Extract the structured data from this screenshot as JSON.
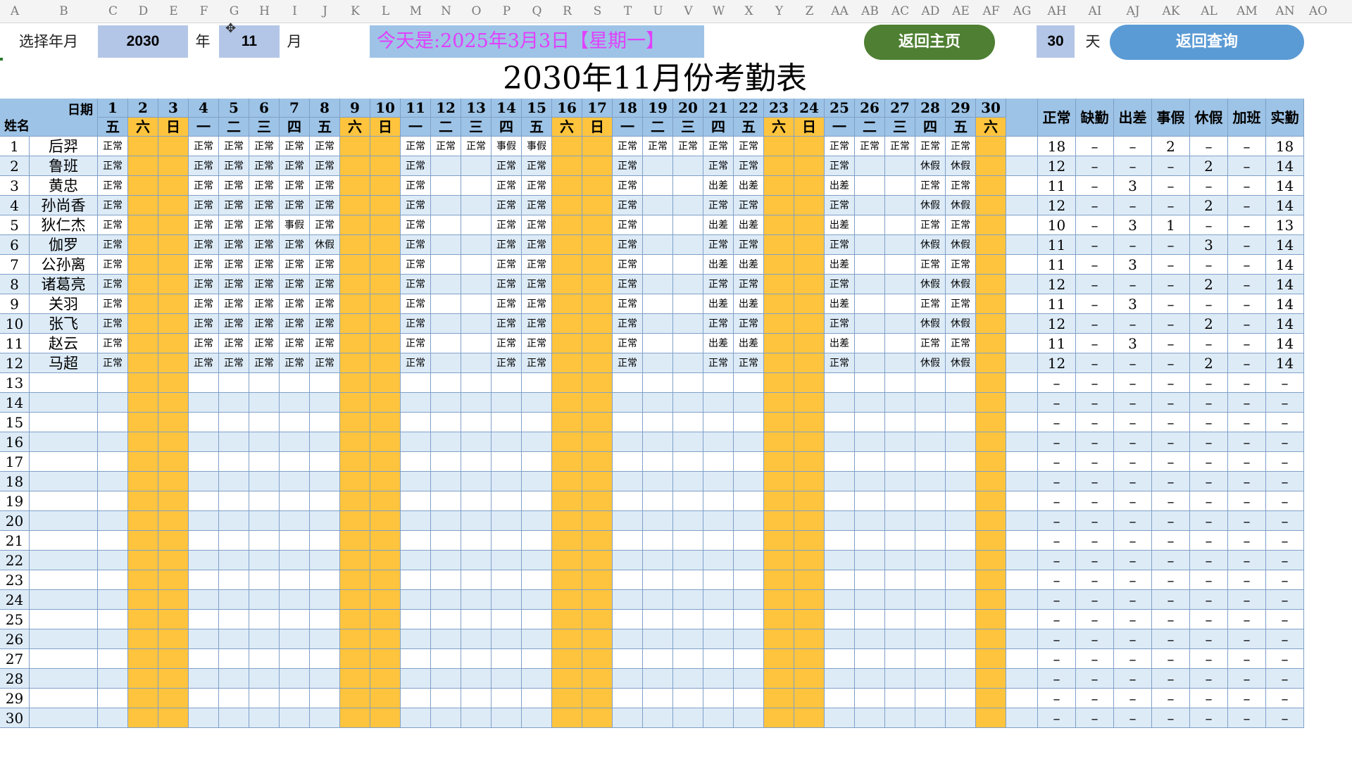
{
  "column_letters": [
    "A",
    "B",
    "C",
    "D",
    "E",
    "F",
    "G",
    "H",
    "I",
    "J",
    "K",
    "L",
    "M",
    "N",
    "O",
    "P",
    "Q",
    "R",
    "S",
    "T",
    "U",
    "V",
    "W",
    "X",
    "Y",
    "Z",
    "AA",
    "AB",
    "AC",
    "AD",
    "AE",
    "AF",
    "AG",
    "AH",
    "AI",
    "AJ",
    "AK",
    "AL",
    "AM",
    "AN",
    "AO"
  ],
  "controls": {
    "select_label": "选择年月",
    "year_value": "2030",
    "year_unit": "年",
    "month_value": "11",
    "month_unit": "月",
    "today_text": "今天是:2025年3月3日【星期一】",
    "home_button": "返回主页",
    "days_value": "30",
    "days_unit": "天",
    "query_button": "返回查询"
  },
  "title": "2030年11月份考勤表",
  "header": {
    "date_label": "日期",
    "name_label": "姓名",
    "days": [
      "1",
      "2",
      "3",
      "4",
      "5",
      "6",
      "7",
      "8",
      "9",
      "10",
      "11",
      "12",
      "13",
      "14",
      "15",
      "16",
      "17",
      "18",
      "19",
      "20",
      "21",
      "22",
      "23",
      "24",
      "25",
      "26",
      "27",
      "28",
      "29",
      "30"
    ],
    "weekdays": [
      "五",
      "六",
      "日",
      "一",
      "二",
      "三",
      "四",
      "五",
      "六",
      "日",
      "一",
      "二",
      "三",
      "四",
      "五",
      "六",
      "日",
      "一",
      "二",
      "三",
      "四",
      "五",
      "六",
      "日",
      "一",
      "二",
      "三",
      "四",
      "五",
      "六"
    ],
    "summary": [
      "正常",
      "缺勤",
      "出差",
      "事假",
      "休假",
      "加班",
      "实勤"
    ]
  },
  "weekend_days": [
    2,
    3,
    9,
    10,
    16,
    17,
    23,
    24,
    30
  ],
  "rows": [
    {
      "no": "1",
      "name": "后羿",
      "marks": {
        "1": "正常",
        "4": "正常",
        "5": "正常",
        "6": "正常",
        "7": "正常",
        "8": "正常",
        "11": "正常",
        "12": "正常",
        "13": "正常",
        "14": "事假",
        "15": "事假",
        "18": "正常",
        "19": "正常",
        "20": "正常",
        "21": "正常",
        "22": "正常",
        "25": "正常",
        "26": "正常",
        "27": "正常",
        "28": "正常",
        "29": "正常"
      },
      "summary": [
        "18",
        "–",
        "–",
        "2",
        "–",
        "–",
        "18"
      ]
    },
    {
      "no": "2",
      "name": "鲁班",
      "marks": {
        "1": "正常",
        "4": "正常",
        "5": "正常",
        "6": "正常",
        "7": "正常",
        "8": "正常",
        "11": "正常",
        "14": "正常",
        "15": "正常",
        "18": "正常",
        "21": "正常",
        "22": "正常",
        "25": "正常",
        "28": "休假",
        "29": "休假"
      },
      "summary": [
        "12",
        "–",
        "–",
        "–",
        "2",
        "–",
        "14"
      ]
    },
    {
      "no": "3",
      "name": "黄忠",
      "marks": {
        "1": "正常",
        "4": "正常",
        "5": "正常",
        "6": "正常",
        "7": "正常",
        "8": "正常",
        "11": "正常",
        "14": "正常",
        "15": "正常",
        "18": "正常",
        "21": "出差",
        "22": "出差",
        "25": "出差",
        "28": "正常",
        "29": "正常"
      },
      "summary": [
        "11",
        "–",
        "3",
        "–",
        "–",
        "–",
        "14"
      ]
    },
    {
      "no": "4",
      "name": "孙尚香",
      "marks": {
        "1": "正常",
        "4": "正常",
        "5": "正常",
        "6": "正常",
        "7": "正常",
        "8": "正常",
        "11": "正常",
        "14": "正常",
        "15": "正常",
        "18": "正常",
        "21": "正常",
        "22": "正常",
        "25": "正常",
        "28": "休假",
        "29": "休假"
      },
      "summary": [
        "12",
        "–",
        "–",
        "–",
        "2",
        "–",
        "14"
      ]
    },
    {
      "no": "5",
      "name": "狄仁杰",
      "marks": {
        "1": "正常",
        "4": "正常",
        "5": "正常",
        "6": "正常",
        "7": "事假",
        "8": "正常",
        "11": "正常",
        "14": "正常",
        "15": "正常",
        "18": "正常",
        "21": "出差",
        "22": "出差",
        "25": "出差",
        "28": "正常",
        "29": "正常"
      },
      "summary": [
        "10",
        "–",
        "3",
        "1",
        "–",
        "–",
        "13"
      ]
    },
    {
      "no": "6",
      "name": "伽罗",
      "marks": {
        "1": "正常",
        "4": "正常",
        "5": "正常",
        "6": "正常",
        "7": "正常",
        "8": "休假",
        "11": "正常",
        "14": "正常",
        "15": "正常",
        "18": "正常",
        "21": "正常",
        "22": "正常",
        "25": "正常",
        "28": "休假",
        "29": "休假"
      },
      "summary": [
        "11",
        "–",
        "–",
        "–",
        "3",
        "–",
        "14"
      ]
    },
    {
      "no": "7",
      "name": "公孙离",
      "marks": {
        "1": "正常",
        "4": "正常",
        "5": "正常",
        "6": "正常",
        "7": "正常",
        "8": "正常",
        "11": "正常",
        "14": "正常",
        "15": "正常",
        "18": "正常",
        "21": "出差",
        "22": "出差",
        "25": "出差",
        "28": "正常",
        "29": "正常"
      },
      "summary": [
        "11",
        "–",
        "3",
        "–",
        "–",
        "–",
        "14"
      ]
    },
    {
      "no": "8",
      "name": "诸葛亮",
      "marks": {
        "1": "正常",
        "4": "正常",
        "5": "正常",
        "6": "正常",
        "7": "正常",
        "8": "正常",
        "11": "正常",
        "14": "正常",
        "15": "正常",
        "18": "正常",
        "21": "正常",
        "22": "正常",
        "25": "正常",
        "28": "休假",
        "29": "休假"
      },
      "summary": [
        "12",
        "–",
        "–",
        "–",
        "2",
        "–",
        "14"
      ]
    },
    {
      "no": "9",
      "name": "关羽",
      "marks": {
        "1": "正常",
        "4": "正常",
        "5": "正常",
        "6": "正常",
        "7": "正常",
        "8": "正常",
        "11": "正常",
        "14": "正常",
        "15": "正常",
        "18": "正常",
        "21": "出差",
        "22": "出差",
        "25": "出差",
        "28": "正常",
        "29": "正常"
      },
      "summary": [
        "11",
        "–",
        "3",
        "–",
        "–",
        "–",
        "14"
      ]
    },
    {
      "no": "10",
      "name": "张飞",
      "marks": {
        "1": "正常",
        "4": "正常",
        "5": "正常",
        "6": "正常",
        "7": "正常",
        "8": "正常",
        "11": "正常",
        "14": "正常",
        "15": "正常",
        "18": "正常",
        "21": "正常",
        "22": "正常",
        "25": "正常",
        "28": "休假",
        "29": "休假"
      },
      "summary": [
        "12",
        "–",
        "–",
        "–",
        "2",
        "–",
        "14"
      ]
    },
    {
      "no": "11",
      "name": "赵云",
      "marks": {
        "1": "正常",
        "4": "正常",
        "5": "正常",
        "6": "正常",
        "7": "正常",
        "8": "正常",
        "11": "正常",
        "14": "正常",
        "15": "正常",
        "18": "正常",
        "21": "出差",
        "22": "出差",
        "25": "出差",
        "28": "正常",
        "29": "正常"
      },
      "summary": [
        "11",
        "–",
        "3",
        "–",
        "–",
        "–",
        "14"
      ]
    },
    {
      "no": "12",
      "name": "马超",
      "marks": {
        "1": "正常",
        "4": "正常",
        "5": "正常",
        "6": "正常",
        "7": "正常",
        "8": "正常",
        "11": "正常",
        "14": "正常",
        "15": "正常",
        "18": "正常",
        "21": "正常",
        "22": "正常",
        "25": "正常",
        "28": "休假",
        "29": "休假"
      },
      "summary": [
        "12",
        "–",
        "–",
        "–",
        "2",
        "–",
        "14"
      ]
    },
    {
      "no": "13",
      "name": "",
      "marks": {},
      "summary": [
        "–",
        "–",
        "–",
        "–",
        "–",
        "–",
        "–"
      ]
    },
    {
      "no": "14",
      "name": "",
      "marks": {},
      "summary": [
        "–",
        "–",
        "–",
        "–",
        "–",
        "–",
        "–"
      ]
    },
    {
      "no": "15",
      "name": "",
      "marks": {},
      "summary": [
        "–",
        "–",
        "–",
        "–",
        "–",
        "–",
        "–"
      ]
    },
    {
      "no": "16",
      "name": "",
      "marks": {},
      "summary": [
        "–",
        "–",
        "–",
        "–",
        "–",
        "–",
        "–"
      ]
    },
    {
      "no": "17",
      "name": "",
      "marks": {},
      "summary": [
        "–",
        "–",
        "–",
        "–",
        "–",
        "–",
        "–"
      ]
    },
    {
      "no": "18",
      "name": "",
      "marks": {},
      "summary": [
        "–",
        "–",
        "–",
        "–",
        "–",
        "–",
        "–"
      ]
    },
    {
      "no": "19",
      "name": "",
      "marks": {},
      "summary": [
        "–",
        "–",
        "–",
        "–",
        "–",
        "–",
        "–"
      ]
    },
    {
      "no": "20",
      "name": "",
      "marks": {},
      "summary": [
        "–",
        "–",
        "–",
        "–",
        "–",
        "–",
        "–"
      ]
    },
    {
      "no": "21",
      "name": "",
      "marks": {},
      "summary": [
        "–",
        "–",
        "–",
        "–",
        "–",
        "–",
        "–"
      ]
    },
    {
      "no": "22",
      "name": "",
      "marks": {},
      "summary": [
        "–",
        "–",
        "–",
        "–",
        "–",
        "–",
        "–"
      ]
    },
    {
      "no": "23",
      "name": "",
      "marks": {},
      "summary": [
        "–",
        "–",
        "–",
        "–",
        "–",
        "–",
        "–"
      ]
    },
    {
      "no": "24",
      "name": "",
      "marks": {},
      "summary": [
        "–",
        "–",
        "–",
        "–",
        "–",
        "–",
        "–"
      ]
    },
    {
      "no": "25",
      "name": "",
      "marks": {},
      "summary": [
        "–",
        "–",
        "–",
        "–",
        "–",
        "–",
        "–"
      ]
    },
    {
      "no": "26",
      "name": "",
      "marks": {},
      "summary": [
        "–",
        "–",
        "–",
        "–",
        "–",
        "–",
        "–"
      ]
    },
    {
      "no": "27",
      "name": "",
      "marks": {},
      "summary": [
        "–",
        "–",
        "–",
        "–",
        "–",
        "–",
        "–"
      ]
    },
    {
      "no": "28",
      "name": "",
      "marks": {},
      "summary": [
        "–",
        "–",
        "–",
        "–",
        "–",
        "–",
        "–"
      ]
    },
    {
      "no": "29",
      "name": "",
      "marks": {},
      "summary": [
        "–",
        "–",
        "–",
        "–",
        "–",
        "–",
        "–"
      ]
    },
    {
      "no": "30",
      "name": "",
      "marks": {},
      "summary": [
        "–",
        "–",
        "–",
        "–",
        "–",
        "–",
        "–"
      ]
    }
  ]
}
